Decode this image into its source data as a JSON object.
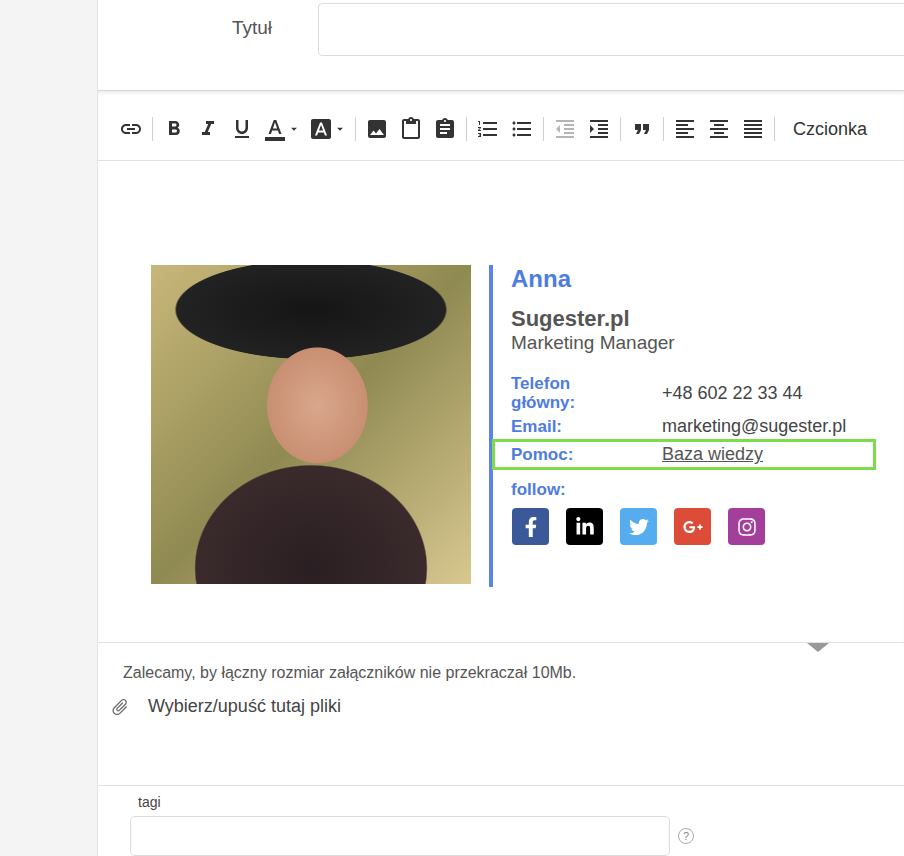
{
  "form": {
    "title_label": "Tytuł",
    "title_value": ""
  },
  "toolbar": {
    "groups": [
      [
        {
          "kind": "link",
          "disabled": false,
          "dropdown": false
        }
      ],
      [
        {
          "kind": "bold",
          "disabled": false,
          "dropdown": false
        },
        {
          "kind": "italic",
          "disabled": false,
          "dropdown": false
        },
        {
          "kind": "underline",
          "disabled": false,
          "dropdown": false
        },
        {
          "kind": "text-color",
          "disabled": false,
          "dropdown": true
        },
        {
          "kind": "bg-color",
          "disabled": false,
          "dropdown": true
        }
      ],
      [
        {
          "kind": "image",
          "disabled": false,
          "dropdown": false
        },
        {
          "kind": "paste-text",
          "disabled": false,
          "dropdown": false
        },
        {
          "kind": "paste-word",
          "disabled": false,
          "dropdown": false
        }
      ],
      [
        {
          "kind": "ordered-list",
          "disabled": false,
          "dropdown": false
        },
        {
          "kind": "bullet-list",
          "disabled": false,
          "dropdown": false
        }
      ],
      [
        {
          "kind": "outdent",
          "disabled": true,
          "dropdown": false
        },
        {
          "kind": "indent",
          "disabled": false,
          "dropdown": false
        }
      ],
      [
        {
          "kind": "quote",
          "disabled": false,
          "dropdown": false
        }
      ],
      [
        {
          "kind": "align-left",
          "disabled": false,
          "dropdown": false
        },
        {
          "kind": "align-center",
          "disabled": false,
          "dropdown": false
        },
        {
          "kind": "align-justify",
          "disabled": false,
          "dropdown": false
        }
      ]
    ],
    "font_menu": "Czcionka"
  },
  "signature": {
    "name": "Anna",
    "company": "Sugester.pl",
    "position": "Marketing Manager",
    "rows": [
      {
        "label": "Telefon główny:",
        "value": "+48 602 22 33 44",
        "kind": "text",
        "highlighted": false
      },
      {
        "label": "Email:",
        "value": "marketing@sugester.pl",
        "kind": "text",
        "highlighted": false
      },
      {
        "label": "Pomoc:",
        "value": "Baza wiedzy",
        "kind": "link",
        "highlighted": true
      }
    ],
    "follow_label": "follow:",
    "socials": [
      {
        "kind": "facebook",
        "color": "#3b5998"
      },
      {
        "kind": "linkedin",
        "color": "#000000"
      },
      {
        "kind": "twitter",
        "color": "#55acee"
      },
      {
        "kind": "googleplus",
        "color": "#dd4b39"
      },
      {
        "kind": "instagram",
        "color": "#a33f9a"
      }
    ]
  },
  "attachments": {
    "note": "Zalecamy, by łączny rozmiar załączników nie przekraczał 10Mb.",
    "dropzone": "Wybierz/upuść tutaj pliki"
  },
  "tags": {
    "label": "tagi",
    "value": "",
    "help": "?"
  }
}
